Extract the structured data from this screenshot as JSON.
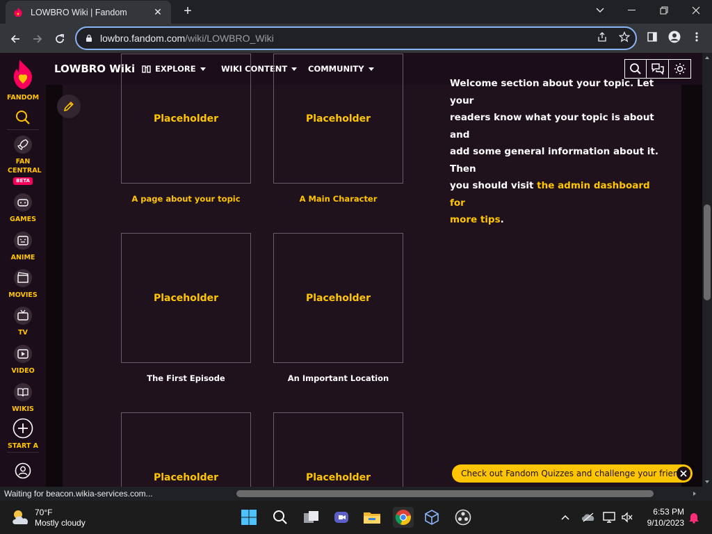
{
  "browser": {
    "tab_title": "LOWBRO Wiki | Fandom",
    "url_host": "lowbro.fandom.com",
    "url_path": "/wiki/LOWBRO_Wiki",
    "status_text": "Waiting for beacon.wikia-services.com..."
  },
  "rail": {
    "logo_label": "FANDOM",
    "fan_central": "FAN CENTRAL",
    "beta": "BETA",
    "games": "GAMES",
    "anime": "ANIME",
    "movies": "MOVIES",
    "tv": "TV",
    "video": "VIDEO",
    "wikis": "WIKIS",
    "start_wiki": "START A WIKI"
  },
  "header": {
    "wiki_name": "LOWBRO Wiki",
    "nav": [
      "EXPLORE",
      "WIKI CONTENT",
      "COMMUNITY"
    ]
  },
  "tiles": [
    {
      "label": "Placeholder",
      "caption": "A page about your topic",
      "caption_color": "#ffc500"
    },
    {
      "label": "Placeholder",
      "caption": "A Main Character",
      "caption_color": "#ffc500"
    },
    {
      "label": "Placeholder",
      "caption": "The First Episode",
      "caption_color": "#ffffff"
    },
    {
      "label": "Placeholder",
      "caption": "An Important Location",
      "caption_color": "#ffffff"
    },
    {
      "label": "Placeholder",
      "caption": ""
    },
    {
      "label": "Placeholder",
      "caption": ""
    }
  ],
  "welcome": {
    "line0": "Welcome section about your topic. Let your",
    "line1": "readers know what your topic is about and",
    "line2": "add some general information about it. Then",
    "line3_text": "you should visit ",
    "line3_link": "the admin dashboard for",
    "line4_link": "more tips",
    "line4_tail": "."
  },
  "quiz_banner": "Check out Fandom Quizzes and challenge your friends!",
  "taskbar": {
    "temperature": "70°F",
    "weather": "Mostly cloudy",
    "time": "6:53 PM",
    "date": "9/10/2023"
  },
  "colors": {
    "fandom_yellow": "#ffc500",
    "fandom_pink": "#fa005a",
    "page_bg": "#1f121d",
    "omnibox_focus": "#8ab4f8"
  }
}
